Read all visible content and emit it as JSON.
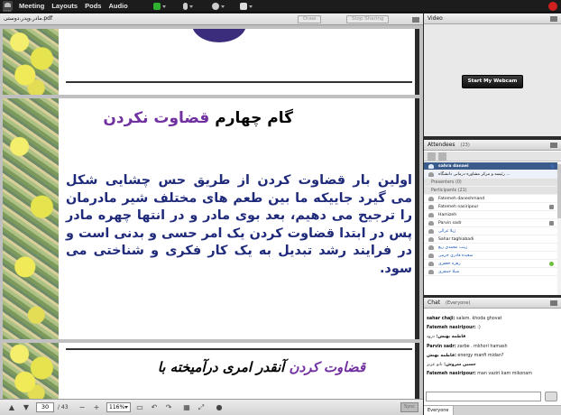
{
  "topbar": {
    "logo_text": "Adobe",
    "menu": [
      "Meeting",
      "Layouts",
      "Pods",
      "Audio"
    ]
  },
  "presentation": {
    "file_name": "مادر.وپدر.دوستی.pdf",
    "buttons": {
      "draw": "Draw",
      "stop_sharing": "Stop Sharing"
    },
    "slide2": {
      "heading_key": "گام  چهارم",
      "heading_value": "قضاوت نکردن",
      "body": "اولین بار قضاوت کردن از طریق حس چشایی شکل می گیرد جاییکه ما بین طعم های مختلف شیر مادرمان را ترجیح می دهیم، بعد بوی مادر و در انتها چهره مادر پس در ابتدا قضاوت کردن یک امر حسی و بدنی است و در فرایند رشد تبدیل به یک کار فکری و شناختی می سود."
    },
    "slide3": {
      "value": "قضاوت کردن",
      "key": "آنقدر امری درآمیخته با"
    },
    "footer": {
      "page": "30",
      "total": "/ 43",
      "zoom": "116%",
      "sync": "Sync"
    }
  },
  "video": {
    "title": "Video",
    "webcam_button": "Start My Webcam"
  },
  "attendees": {
    "title": "Attendees",
    "count": "(23)",
    "host": "sahra danaei",
    "host_sub": "رئیسه و مرکز مشاوره درمانی دانشگاه ...",
    "presenters_label": "Presenters (0)",
    "participants_label": "Participants (21)",
    "participants": [
      {
        "name": "Fatemeh daneshmand",
        "blue": false,
        "icon": ""
      },
      {
        "name": "Fatemeh nasiripour",
        "blue": false,
        "icon": "user"
      },
      {
        "name": "Hamizeh",
        "blue": false,
        "icon": ""
      },
      {
        "name": "Parvin sadr",
        "blue": false,
        "icon": "user"
      },
      {
        "name": "ژیلا غرالی",
        "blue": true,
        "icon": ""
      },
      {
        "name": "Sahar taghiabadi",
        "blue": false,
        "icon": ""
      },
      {
        "name": "زینب محمدی ربع",
        "blue": true,
        "icon": ""
      },
      {
        "name": "سعیده قادری جرمی",
        "blue": true,
        "icon": ""
      },
      {
        "name": "زهره جعفری",
        "blue": true,
        "icon": "green"
      },
      {
        "name": "شیلا جمفری",
        "blue": true,
        "icon": ""
      }
    ]
  },
  "chat": {
    "title": "Chat",
    "scope": "(Everyone)",
    "messages": [
      {
        "from": "sahar chaji:",
        "text": " salam. khoda ghovat"
      },
      {
        "from": "Fatemeh nasiripour:",
        "text": " :)"
      },
      {
        "from": "فاطمه بهنش:",
        "text": " درود"
      },
      {
        "from": "Parvin sadr:",
        "text": " zarbe . mkhori hamash"
      },
      {
        "from": "فاطمه بهنش:",
        "text": " energy manfi midan?"
      },
      {
        "from": "حسین سروش:",
        "text": " بانو عزیز"
      },
      {
        "from": "Fatemeh nasiripour:",
        "text": " man vaziri kam mikonam"
      }
    ],
    "tab": "Everyone"
  }
}
